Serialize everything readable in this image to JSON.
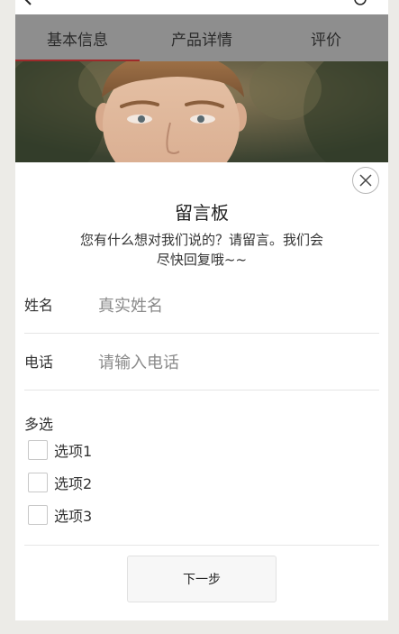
{
  "tabs": [
    {
      "label": "基本信息",
      "active": true
    },
    {
      "label": "产品详情",
      "active": false
    },
    {
      "label": "评价",
      "active": false
    }
  ],
  "colors": {
    "tab_bar": "#8e8e8e",
    "tab_indicator": "#9e2a2a",
    "page_background": "#ecebe7"
  },
  "icons": {
    "back": "back-arrow-icon",
    "info": "info-icon",
    "close": "close-icon"
  },
  "message_board": {
    "title": "留言板",
    "subtitle": "您有什么想对我们说的？请留言。我们会尽快回复哦~~",
    "name_field": {
      "label": "姓名",
      "value": "",
      "placeholder": "真实姓名"
    },
    "phone_field": {
      "label": "电话",
      "value": "",
      "placeholder": "请输入电话"
    },
    "multi_select": {
      "label": "多选",
      "options": [
        {
          "label": "选项1",
          "checked": false
        },
        {
          "label": "选项2",
          "checked": false
        },
        {
          "label": "选项3",
          "checked": false
        }
      ]
    },
    "next_button": "下一步"
  }
}
